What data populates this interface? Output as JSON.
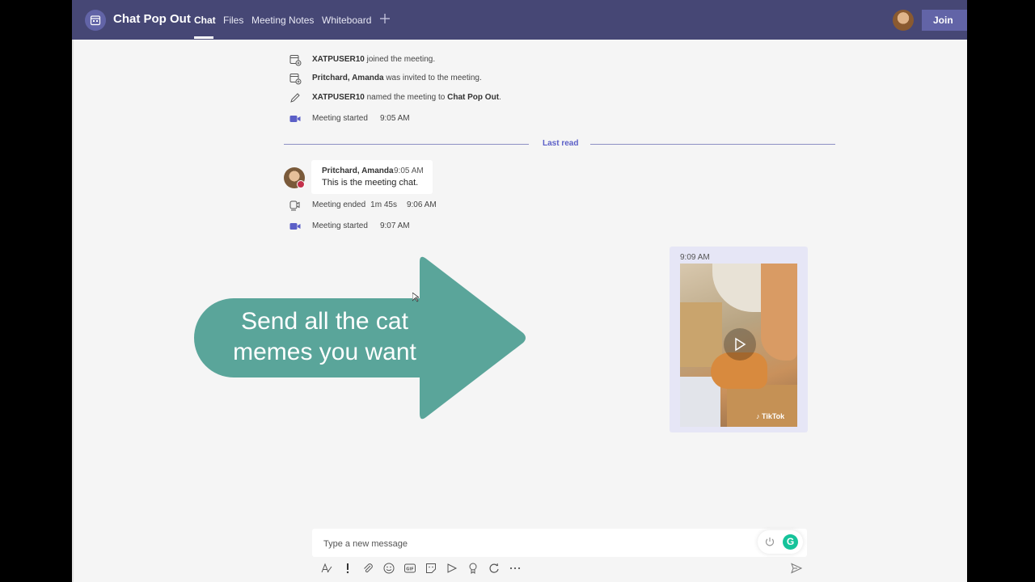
{
  "header": {
    "title": "Chat Pop Out",
    "tabs": [
      {
        "label": "Chat",
        "active": true
      },
      {
        "label": "Files",
        "active": false
      },
      {
        "label": "Meeting Notes",
        "active": false
      },
      {
        "label": "Whiteboard",
        "active": false
      }
    ],
    "add_tab_icon": "plus-icon",
    "join_label": "Join"
  },
  "events": [
    {
      "icon": "calendar-add-icon",
      "bold": "XATPUSER10",
      "rest": " joined the meeting.",
      "time": ""
    },
    {
      "icon": "calendar-add-icon",
      "bold": "Pritchard, Amanda",
      "rest": " was invited to the meeting.",
      "time": ""
    },
    {
      "icon": "pencil-icon",
      "bold": "XATPUSER10",
      "rest": " named the meeting to ",
      "bold2": "Chat Pop Out",
      "rest2": "."
    },
    {
      "icon": "video-camera-icon",
      "text": "Meeting started",
      "time": "9:05 AM"
    }
  ],
  "last_read": "Last read",
  "message": {
    "sender": "Pritchard, Amanda",
    "time": "9:05 AM",
    "text": "This is the meeting chat."
  },
  "events_after": [
    {
      "icon": "call-end-icon",
      "text": "Meeting ended",
      "duration": "1m 45s",
      "time": "9:06 AM"
    },
    {
      "icon": "video-camera-icon",
      "text": "Meeting started",
      "time": "9:07 AM"
    }
  ],
  "sent_message": {
    "time": "9:09 AM",
    "video_watermark": "♪ TikTok"
  },
  "callout": {
    "line1": "Send all the cat",
    "line2": "memes you want",
    "color": "#5aa59a"
  },
  "compose": {
    "placeholder": "Type a new message"
  },
  "compose_toolbar": [
    "format-icon",
    "important-icon",
    "attach-icon",
    "emoji-icon",
    "gif-icon",
    "sticker-icon",
    "meet-now-icon",
    "praise-icon",
    "loop-icon",
    "more-options-icon"
  ],
  "colors": {
    "header_bg": "#464775",
    "accent": "#6264a7",
    "canvas_bg": "#f5f5f5",
    "sent_bubble": "#e6e6f6",
    "grammarly": "#15c39a"
  }
}
